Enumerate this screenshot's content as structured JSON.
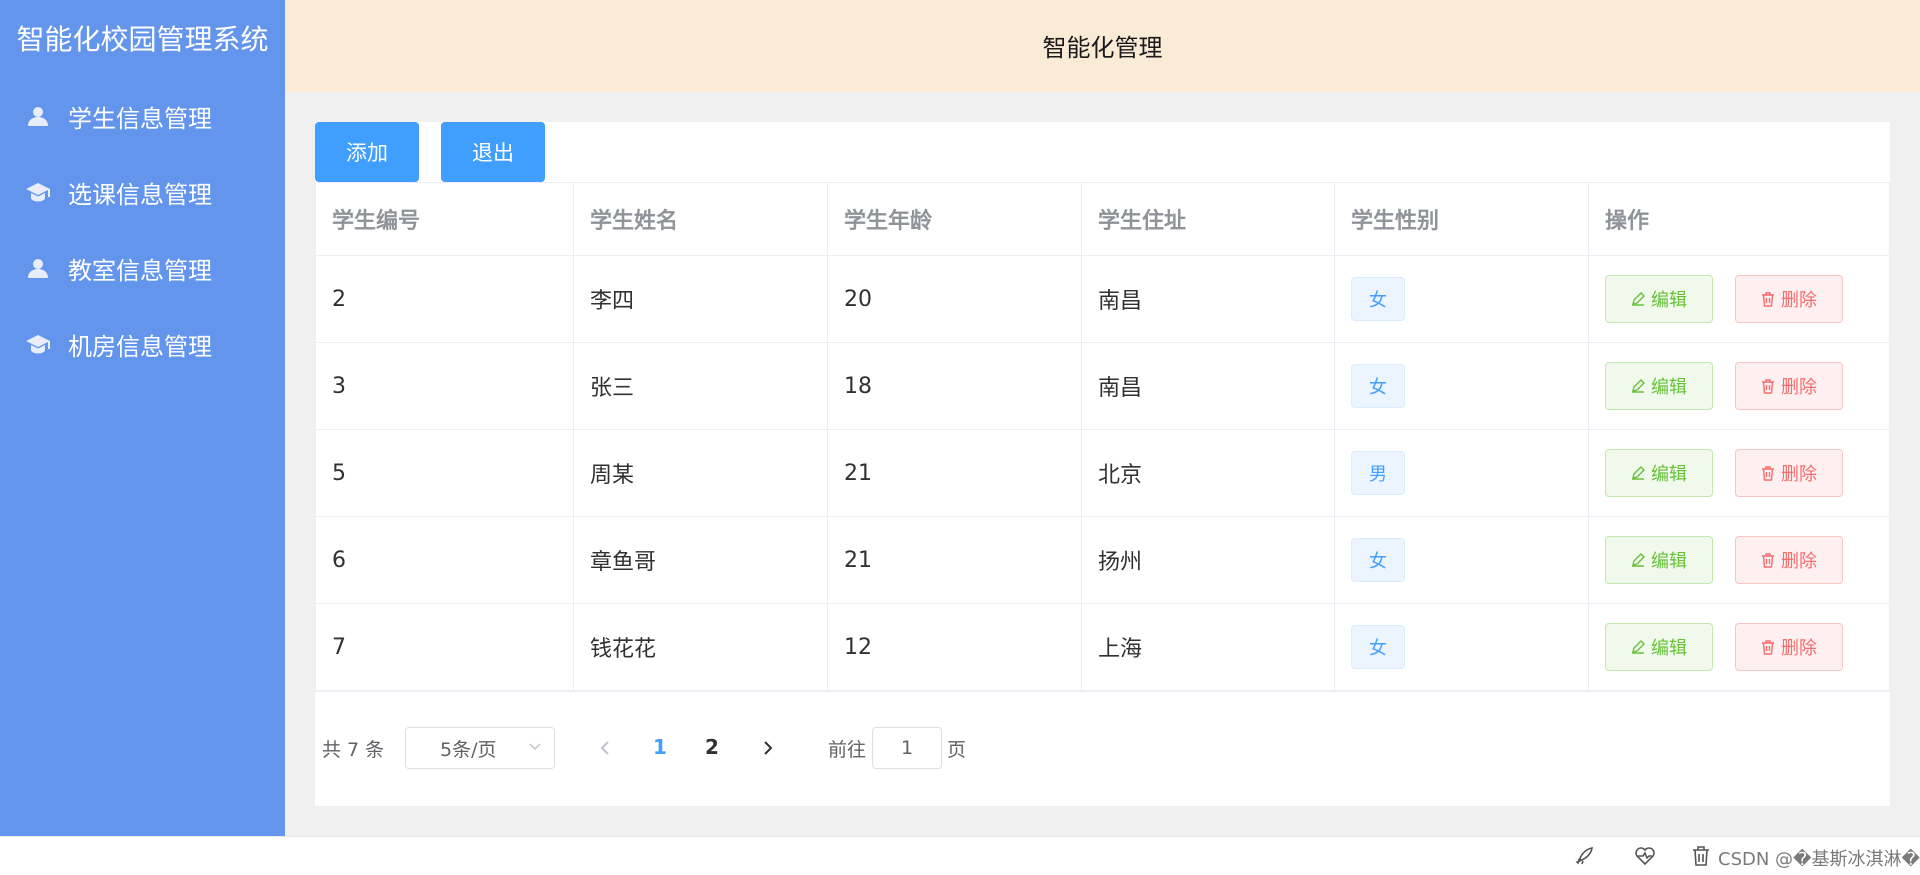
{
  "app_title": "智能化校园管理系统",
  "header_title": "智能化管理",
  "sidebar": {
    "items": [
      {
        "label": "学生信息管理",
        "icon": "user-icon"
      },
      {
        "label": "选课信息管理",
        "icon": "graduation-cap-icon"
      },
      {
        "label": "教室信息管理",
        "icon": "user-icon"
      },
      {
        "label": "机房信息管理",
        "icon": "graduation-cap-icon"
      }
    ]
  },
  "toolbar": {
    "add_label": "添加",
    "exit_label": "退出"
  },
  "table": {
    "columns": [
      "学生编号",
      "学生姓名",
      "学生年龄",
      "学生住址",
      "学生性别",
      "操作"
    ],
    "rows": [
      {
        "id": "2",
        "name": "李四",
        "age": "20",
        "address": "南昌",
        "gender": "女"
      },
      {
        "id": "3",
        "name": "张三",
        "age": "18",
        "address": "南昌",
        "gender": "女"
      },
      {
        "id": "5",
        "name": "周某",
        "age": "21",
        "address": "北京",
        "gender": "男"
      },
      {
        "id": "6",
        "name": "章鱼哥",
        "age": "21",
        "address": "扬州",
        "gender": "女"
      },
      {
        "id": "7",
        "name": "钱花花",
        "age": "12",
        "address": "上海",
        "gender": "女"
      }
    ],
    "edit_label": "编辑",
    "delete_label": "删除"
  },
  "pagination": {
    "total_text": "共 7 条",
    "page_size": "5条/页",
    "pages": [
      "1",
      "2"
    ],
    "current_page": "1",
    "goto_label": "前往",
    "goto_value": "1",
    "page_suffix": "页"
  },
  "bottom_bar": {
    "watermark": "CSDN @�基斯冰淇淋�"
  },
  "colors": {
    "sidebar": "#6495ed",
    "header": "#faebd7",
    "primary": "#409eff",
    "success": "#67c23a",
    "danger": "#f56c6c"
  }
}
